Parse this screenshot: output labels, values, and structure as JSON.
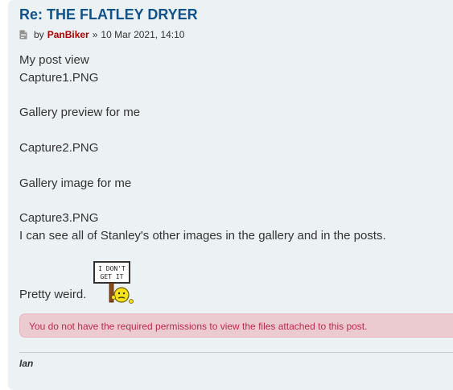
{
  "post": {
    "title": "Re: THE FLATLEY DRYER",
    "byline": {
      "prefix": "by",
      "author": "PanBiker",
      "separator": "»",
      "date": "10 Mar 2021, 14:10"
    },
    "content_lines": [
      "My post view",
      "Capture1.PNG",
      "Gallery preview for me",
      "Capture2.PNG",
      "Gallery image for me",
      "Capture3.PNG",
      "I can see all of Stanley's other images in the gallery and in the posts.",
      "Pretty weird."
    ],
    "smiley_sign_text": [
      "I DON'T",
      "GET IT"
    ],
    "notice": "You do not have the required permissions to view the files attached to this post.",
    "signature": "Ian"
  },
  "colors": {
    "post_background": "#ecf1f3",
    "title": "#105289",
    "author": "#aa0000",
    "notice_background": "#eccbd0",
    "notice_text": "#bc2a4d"
  }
}
